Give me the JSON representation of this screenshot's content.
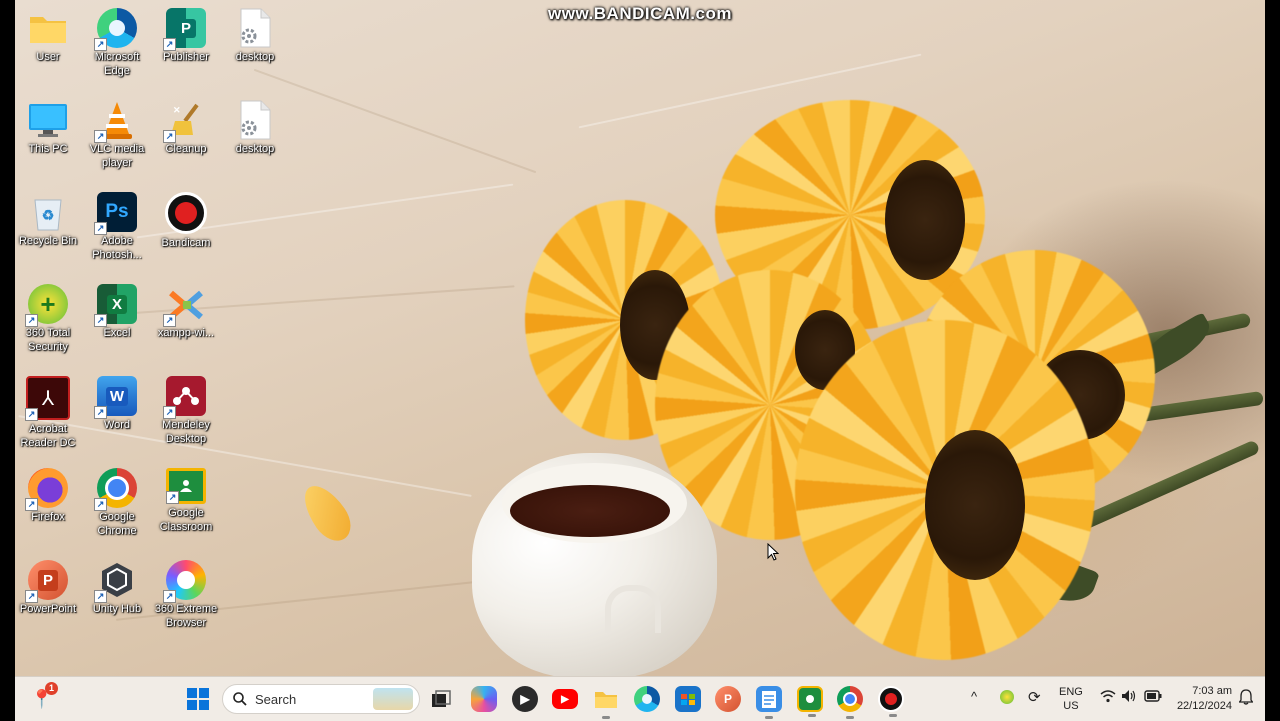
{
  "watermark": "www.BANDICAM.com",
  "desktop_icons": [
    {
      "label": "User",
      "icon": "folder-icon",
      "color": "#f5c242"
    },
    {
      "label": "This PC",
      "icon": "monitor-icon",
      "color": "#2a9be0"
    },
    {
      "label": "Recycle Bin",
      "icon": "recycle-bin-icon",
      "color": "#dde8f2"
    },
    {
      "label": "360 Total Security",
      "icon": "360-security-icon",
      "color": "#6cc04a"
    },
    {
      "label": "Acrobat Reader DC",
      "icon": "acrobat-icon",
      "color": "#4a0a0a"
    },
    {
      "label": "Firefox",
      "icon": "firefox-icon",
      "color": "#ff7139"
    },
    {
      "label": "PowerPoint",
      "icon": "powerpoint-icon",
      "color": "#d35230"
    },
    {
      "label": "Microsoft Edge",
      "icon": "edge-icon",
      "color": "#1b8fd8"
    },
    {
      "label": "VLC media player",
      "icon": "vlc-icon",
      "color": "#f08a00"
    },
    {
      "label": "Adobe Photosh...",
      "icon": "photoshop-icon",
      "color": "#001e36"
    },
    {
      "label": "Excel",
      "icon": "excel-icon",
      "color": "#1d7044"
    },
    {
      "label": "Word",
      "icon": "word-icon",
      "color": "#185abd"
    },
    {
      "label": "Google Chrome",
      "icon": "chrome-icon",
      "color": "#db4437"
    },
    {
      "label": "Unity Hub",
      "icon": "unity-hub-icon",
      "color": "#3a3f46"
    },
    {
      "label": "Publisher",
      "icon": "publisher-icon",
      "color": "#077568"
    },
    {
      "label": "Cleanup",
      "icon": "cleanup-icon",
      "color": "#e0b040"
    },
    {
      "label": "Bandicam",
      "icon": "bandicam-icon",
      "color": "#d31e1e"
    },
    {
      "label": "xampp-wi...",
      "icon": "xampp-icon",
      "color": "#fb7a24"
    },
    {
      "label": "Mendeley Desktop",
      "icon": "mendeley-icon",
      "color": "#a6192e"
    },
    {
      "label": "Google Classroom",
      "icon": "classroom-icon",
      "color": "#1e8e3e"
    },
    {
      "label": "360 Extreme Browser",
      "icon": "360-browser-icon",
      "color": "#3fa9f5"
    },
    {
      "label": "desktop",
      "icon": "settings-file-icon",
      "color": "#ffffff"
    },
    {
      "label": "desktop",
      "icon": "settings-file-icon",
      "color": "#ffffff"
    }
  ],
  "taskbar": {
    "search_placeholder": "Search",
    "notification_badge": "1",
    "pinned": [
      {
        "name": "task-view",
        "icon": "task-view-icon"
      },
      {
        "name": "copilot",
        "icon": "copilot-icon"
      },
      {
        "name": "media-player",
        "icon": "media-player-icon"
      },
      {
        "name": "youtube",
        "icon": "youtube-icon"
      },
      {
        "name": "file-explorer",
        "icon": "folder-icon"
      },
      {
        "name": "edge",
        "icon": "edge-icon"
      },
      {
        "name": "store",
        "icon": "store-icon"
      },
      {
        "name": "powerpoint",
        "icon": "powerpoint-icon"
      },
      {
        "name": "notepad",
        "icon": "notepad-icon"
      },
      {
        "name": "classroom",
        "icon": "classroom-icon"
      },
      {
        "name": "chrome",
        "icon": "chrome-icon"
      },
      {
        "name": "bandicam",
        "icon": "bandicam-icon"
      }
    ],
    "tray": {
      "language_line1": "ENG",
      "language_line2": "US",
      "time": "7:03 am",
      "date": "22/12/2024"
    }
  }
}
